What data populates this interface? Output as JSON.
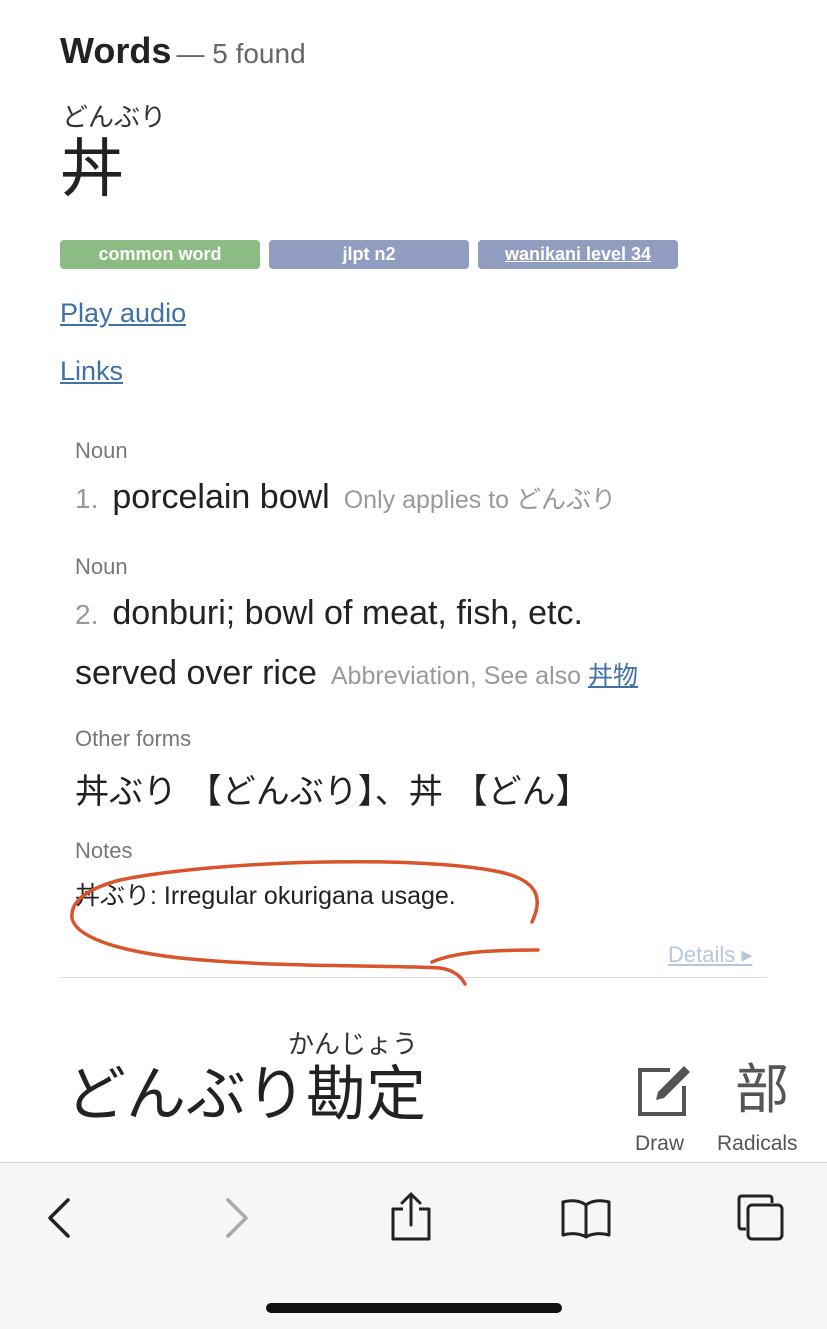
{
  "header": {
    "title": "Words",
    "count_text": "— 5 found"
  },
  "entry": {
    "furigana": "どんぶり",
    "kanji": "丼",
    "tags": [
      "common word",
      "jlpt n2",
      "wanikani level 34"
    ],
    "play_audio": "Play audio",
    "links": "Links",
    "senses": [
      {
        "pos": "Noun",
        "number": "1.",
        "meaning": "porcelain bowl",
        "info": "Only applies to どんぶり"
      },
      {
        "pos": "Noun",
        "number": "2.",
        "meaning_line1": "donburi; bowl of meat, fish, etc.",
        "meaning_line2": "served over rice",
        "info_prefix": "Abbreviation, See also",
        "info_link": "丼物"
      }
    ],
    "other_forms_label": "Other forms",
    "other_forms": "丼ぶり 【どんぶり】、丼 【どん】",
    "notes_label": "Notes",
    "notes": "丼ぶり: Irregular okurigana usage.",
    "details": "Details ▸"
  },
  "input_bar": {
    "furigana": "かんじょう",
    "text": "どんぶり勘定",
    "draw_label": "Draw",
    "radicals_glyph": "部",
    "radicals_label": "Radicals"
  },
  "icons": {
    "draw": "pencil-square-icon",
    "back": "chevron-left-icon",
    "forward": "chevron-right-icon",
    "share": "share-icon",
    "bookmarks": "book-icon",
    "tabs": "tabs-icon"
  },
  "colors": {
    "common_tag": "#8abc83",
    "jlpt_tag": "#909dc0",
    "link": "#3f71a6",
    "annotation": "#d9532b"
  }
}
